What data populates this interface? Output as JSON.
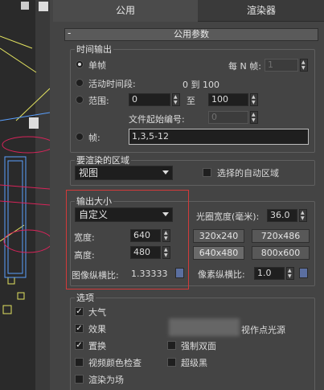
{
  "tabs": [
    {
      "label": "公用"
    },
    {
      "label": "渲染器"
    }
  ],
  "rollout": {
    "title": "公用参数"
  },
  "time_output": {
    "title": "时间输出",
    "single": "单帧",
    "every_n_label": "每 N 帧:",
    "every_n_value": "1",
    "active_segment": "活动时间段:",
    "active_range": "0 到 100",
    "range_label": "范围:",
    "range_from": "0",
    "range_to_label": "至",
    "range_to": "100",
    "file_start_label": "文件起始编号:",
    "file_start_value": "0",
    "frames_label": "帧:",
    "frames_value": "1,3,5-12"
  },
  "area": {
    "title": "要渲染的区域",
    "selected": "视图",
    "auto_region_label": "选择的自动区域"
  },
  "output_size": {
    "title": "输出大小",
    "preset": "自定义",
    "aperture_label": "光圈宽度(毫米):",
    "aperture_value": "36.0",
    "width_label": "宽度:",
    "width_value": "640",
    "height_label": "高度:",
    "height_value": "480",
    "presets": [
      "320x240",
      "720x486",
      "640x480",
      "800x600"
    ],
    "image_aspect_label": "图像纵横比:",
    "image_aspect_value": "1.33333",
    "pixel_aspect_label": "像素纵横比:",
    "pixel_aspect_value": "1.0"
  },
  "options": {
    "title": "选项",
    "atmosphere": "大气",
    "effects": "效果",
    "displacement": "置换",
    "force_2sided": "强制双面",
    "video_color_check": "视频颜色检查",
    "super_black": "超级黑",
    "render_to_fields": "渲染为场",
    "area_lights_partial": "视作点光源"
  },
  "icons": [
    "lock-icon",
    "chevron-down-icon",
    "spinner-arrows-icon"
  ]
}
